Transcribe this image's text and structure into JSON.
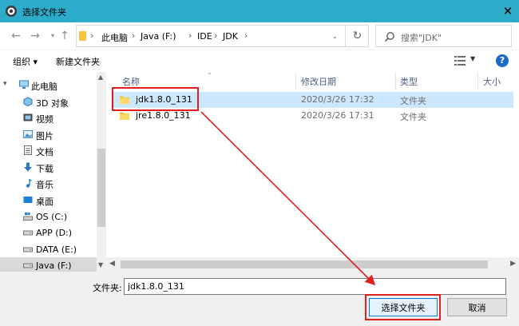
{
  "window": {
    "title": "选择文件夹"
  },
  "address": {
    "crumbs": [
      "此电脑",
      "Java (F:)",
      "IDE",
      "JDK"
    ]
  },
  "search": {
    "placeholder": "搜索\"JDK\""
  },
  "toolbar": {
    "organize": "组织 ▾",
    "new_folder": "新建文件夹"
  },
  "sidebar": {
    "items": [
      {
        "label": "此电脑",
        "icon": "computer-icon"
      },
      {
        "label": "3D 对象",
        "icon": "3d-objects-icon"
      },
      {
        "label": "视频",
        "icon": "video-icon"
      },
      {
        "label": "图片",
        "icon": "pictures-icon"
      },
      {
        "label": "文档",
        "icon": "documents-icon"
      },
      {
        "label": "下载",
        "icon": "download-icon"
      },
      {
        "label": "音乐",
        "icon": "music-icon"
      },
      {
        "label": "桌面",
        "icon": "desktop-icon"
      },
      {
        "label": "OS (C:)",
        "icon": "drive-icon"
      },
      {
        "label": "APP (D:)",
        "icon": "drive-icon"
      },
      {
        "label": "DATA (E:)",
        "icon": "drive-icon"
      },
      {
        "label": "Java (F:)",
        "icon": "drive-icon"
      }
    ]
  },
  "filelist": {
    "columns": [
      "名称",
      "修改日期",
      "类型",
      "大小"
    ],
    "rows": [
      {
        "name": "jdk1.8.0_131",
        "date": "2020/3/26 17:32",
        "type": "文件夹",
        "selected": true
      },
      {
        "name": "jre1.8.0_131",
        "date": "2020/3/26 17:31",
        "type": "文件夹",
        "selected": false
      }
    ]
  },
  "footer": {
    "filename_label": "文件夹:",
    "filename_value": "jdk1.8.0_131",
    "select_button": "选择文件夹",
    "cancel_button": "取消"
  },
  "colors": {
    "titlebar": "#2cabca",
    "selection": "#cce8ff",
    "annotation": "#e02020",
    "folder": "#f5c542"
  }
}
